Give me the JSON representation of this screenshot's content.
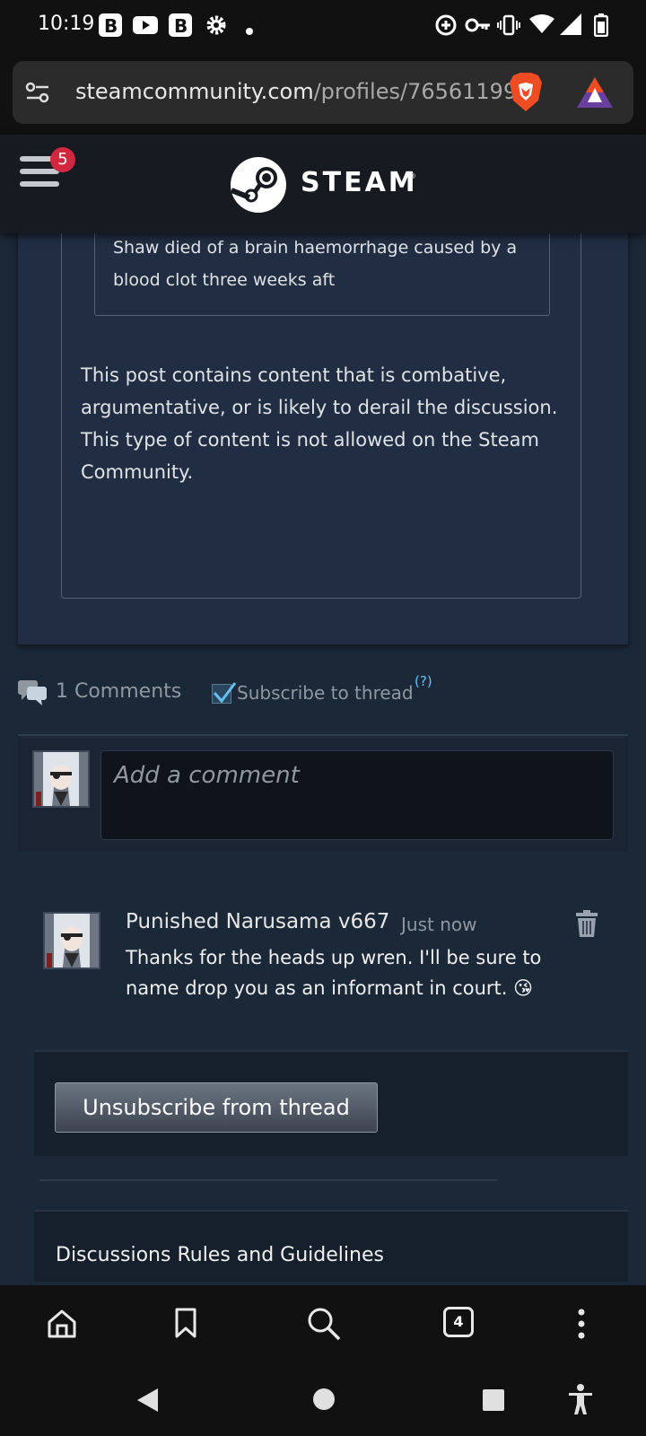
{
  "status_bar": {
    "time": "10:19",
    "icons": [
      "b-app-icon",
      "youtube-icon",
      "b-app-icon",
      "settings-icon",
      "dot-icon",
      "data-saver-icon",
      "vpn-key-icon",
      "vibrate-icon",
      "wifi-icon",
      "signal-icon",
      "battery-icon"
    ]
  },
  "browser": {
    "url_domain": "steamcommunity.com",
    "url_path": "/profiles/76561199",
    "tab_count": "4"
  },
  "steam_header": {
    "brand": "STEAM",
    "notification_count": "5"
  },
  "post": {
    "quote_text": "Shaw died of a brain haemorrhage caused by a blood clot three weeks aft",
    "warning_text": "This post contains content that is combative, argumentative, or is likely to derail the discussion. This type of content is not allowed on the Steam Community."
  },
  "comments": {
    "count_label": "1 Comments",
    "subscribe_label": "Subscribe to thread",
    "subscribe_checked": true,
    "help_label": "(?)",
    "input_placeholder": "Add a comment",
    "items": [
      {
        "author": "Punished Narusama v667",
        "time": "Just now",
        "text": "Thanks for the heads up wren. I'll be sure to name drop you as an informant in court. 😘"
      }
    ]
  },
  "actions": {
    "unsubscribe_label": "Unsubscribe from thread"
  },
  "footer": {
    "rules_label": "Discussions Rules and Guidelines"
  },
  "colors": {
    "steam_header": "#171a21",
    "page_bg": "#1b2838",
    "post_bg": "#212d42",
    "badge": "#d1283f",
    "link_blue": "#66c0f4"
  }
}
